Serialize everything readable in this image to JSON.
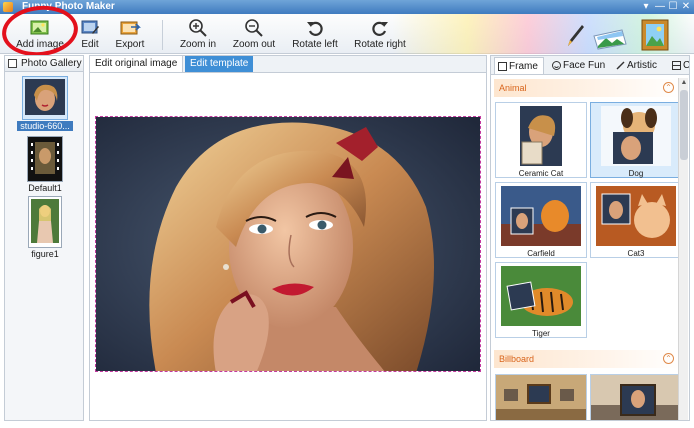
{
  "window": {
    "title": "Funny Photo Maker",
    "controls": [
      "▾",
      "—",
      "☐",
      "✕"
    ]
  },
  "toolbar": {
    "buttons": [
      {
        "label": "Add image",
        "icon": "add-image-icon"
      },
      {
        "label": "Edit",
        "icon": "edit-icon"
      },
      {
        "label": "Export",
        "icon": "export-icon"
      },
      {
        "label": "Zoom in",
        "icon": "zoom-in-icon"
      },
      {
        "label": "Zoom out",
        "icon": "zoom-out-icon"
      },
      {
        "label": "Rotate left",
        "icon": "rotate-left-icon"
      },
      {
        "label": "Rotate right",
        "icon": "rotate-right-icon"
      }
    ]
  },
  "gallery": {
    "title": "Photo Gallery",
    "items": [
      {
        "label": "studio-660..."
      },
      {
        "label": "Default1"
      },
      {
        "label": "figure1"
      }
    ]
  },
  "editor": {
    "tabs": [
      "Edit original image",
      "Edit template"
    ]
  },
  "templates": {
    "tabs": [
      "Frame",
      "Face Fun",
      "Artistic",
      "C"
    ],
    "sections": [
      {
        "name": "Animal",
        "collapse": "⌃",
        "items": [
          "Ceramic Cat",
          "Dog",
          "Carfield",
          "Cat3",
          "Tiger"
        ]
      },
      {
        "name": "Billboard",
        "collapse": "⌃",
        "items": []
      }
    ]
  },
  "colors": {
    "accent": "#3f7bbf",
    "highlight": "#e3101c",
    "section": "#d9651c"
  }
}
